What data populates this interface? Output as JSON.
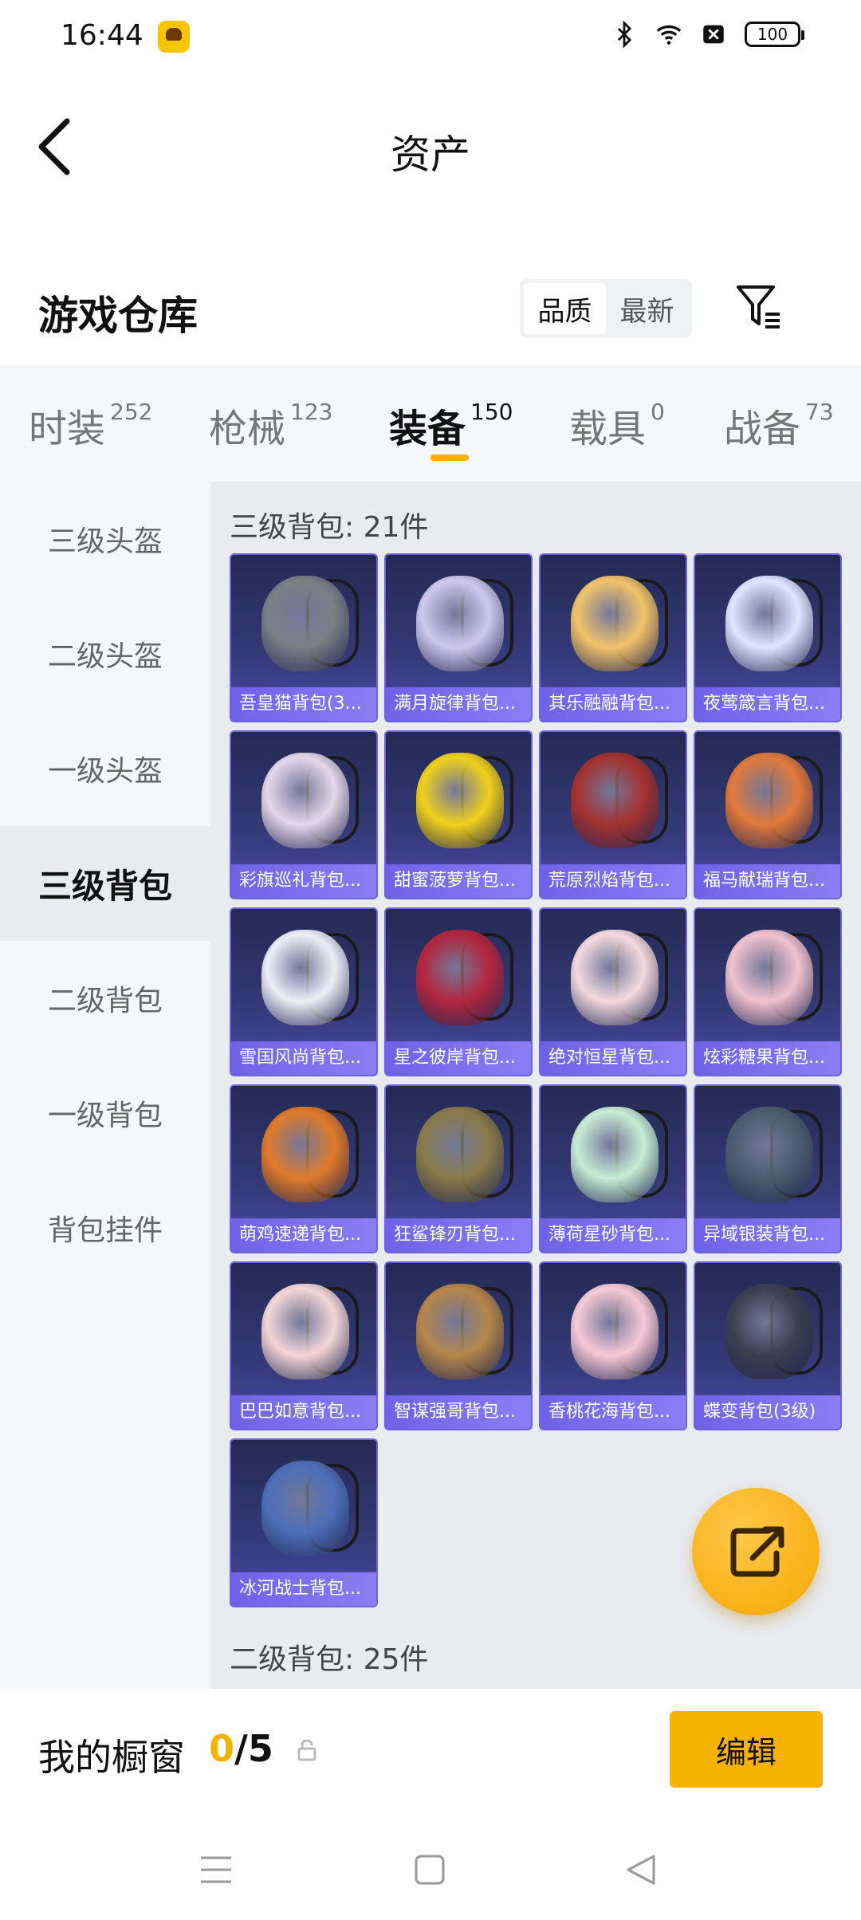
{
  "status_bar": {
    "time": "16:44",
    "battery": "100"
  },
  "header": {
    "title": "资产"
  },
  "warehouse": {
    "title": "游戏仓库",
    "sort": {
      "options": [
        "品质",
        "最新"
      ],
      "selected": "品质"
    }
  },
  "tabs": [
    {
      "label": "时装",
      "count": "252"
    },
    {
      "label": "枪械",
      "count": "123"
    },
    {
      "label": "装备",
      "count": "150"
    },
    {
      "label": "载具",
      "count": "0"
    },
    {
      "label": "战备",
      "count": "73"
    }
  ],
  "active_tab": "装备",
  "sidebar": {
    "items": [
      "三级头盔",
      "二级头盔",
      "一级头盔",
      "三级背包",
      "二级背包",
      "一级背包",
      "背包挂件"
    ],
    "active": "三级背包"
  },
  "sections": [
    {
      "header": "三级背包: 21件",
      "items": [
        {
          "name": "吾皇猫背包(3...",
          "color": "#7a7f86"
        },
        {
          "name": "满月旋律背包...",
          "color": "#cfc8ee"
        },
        {
          "name": "其乐融融背包...",
          "color": "#f2c36a"
        },
        {
          "name": "夜莺箴言背包...",
          "color": "#dfe6ff"
        },
        {
          "name": "彩旗巡礼背包...",
          "color": "#e6d7ea"
        },
        {
          "name": "甜蜜菠萝背包...",
          "color": "#f1d11c"
        },
        {
          "name": "荒原烈焰背包...",
          "color": "#a43230"
        },
        {
          "name": "福马献瑞背包...",
          "color": "#e2793b"
        },
        {
          "name": "雪国风尚背包...",
          "color": "#eeeef8"
        },
        {
          "name": "星之彼岸背包...",
          "color": "#b3263e"
        },
        {
          "name": "绝对恒星背包...",
          "color": "#f4d9de"
        },
        {
          "name": "炫彩糖果背包...",
          "color": "#f0c2cf"
        },
        {
          "name": "萌鸡速递背包...",
          "color": "#e07a2a"
        },
        {
          "name": "狂鲨锋刃背包...",
          "color": "#8a7a4a"
        },
        {
          "name": "薄荷星砂背包...",
          "color": "#c8ecd6"
        },
        {
          "name": "异域银装背包...",
          "color": "#4a5d6e"
        },
        {
          "name": "巴巴如意背包...",
          "color": "#f3d6d8"
        },
        {
          "name": "智谋强哥背包...",
          "color": "#b5864a"
        },
        {
          "name": "香桃花海背包...",
          "color": "#f7cad7"
        },
        {
          "name": "蝶变背包(3级)",
          "color": "#3a3f4e"
        },
        {
          "name": "冰河战士背包...",
          "color": "#4d6fb8"
        }
      ]
    },
    {
      "header": "二级背包: 25件",
      "items": []
    }
  ],
  "showcase": {
    "title": "我的橱窗",
    "current": "0",
    "separator": "/",
    "max": "5",
    "edit_label": "编辑"
  },
  "colors": {
    "accent": "#f5b300",
    "card_top": "#232a52",
    "card_label": "#7a6cf0"
  }
}
